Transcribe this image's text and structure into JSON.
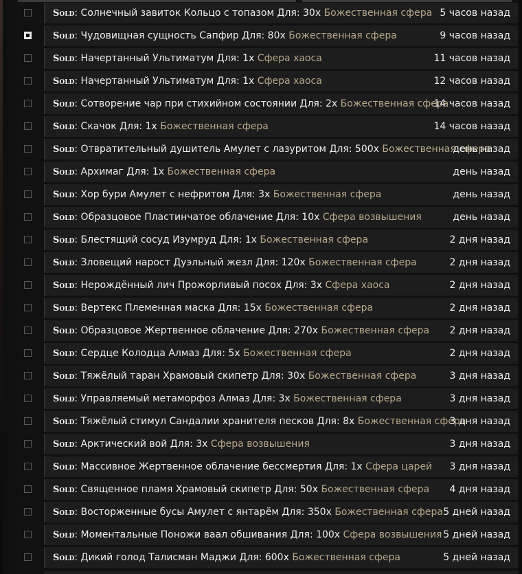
{
  "sold_label": "Sold",
  "sold_sep": ":",
  "for_word": "Для:",
  "rows": [
    {
      "checked": false,
      "item": "Солнечный завиток Кольцо с топазом",
      "qty": "30x",
      "currency": "Божественная сфера",
      "time": "5 часов назад"
    },
    {
      "checked": true,
      "item": "Чудовищная сущность Сапфир",
      "qty": "80x",
      "currency": "Божественная сфера",
      "time": "9 часов назад"
    },
    {
      "checked": false,
      "item": "Начертанный Ультиматум",
      "qty": "1x",
      "currency": "Сфера хаоса",
      "time": "11 часов назад"
    },
    {
      "checked": false,
      "item": "Начертанный Ультиматум",
      "qty": "1x",
      "currency": "Сфера хаоса",
      "time": "12 часов назад"
    },
    {
      "checked": false,
      "item": "Сотворение чар при стихийном состоянии",
      "qty": "2x",
      "currency": "Божественная сфера",
      "time": "14 часов назад"
    },
    {
      "checked": false,
      "item": "Скачок",
      "qty": "1x",
      "currency": "Божественная сфера",
      "time": "14 часов назад"
    },
    {
      "checked": false,
      "item": "Отвратительный душитель Амулет с лазуритом",
      "qty": "500x",
      "currency": "Божественная сфера",
      "time": "день назад"
    },
    {
      "checked": false,
      "item": "Архимаг",
      "qty": "1x",
      "currency": "Божественная сфера",
      "time": "день назад"
    },
    {
      "checked": false,
      "item": "Хор бури Амулет с нефритом",
      "qty": "3x",
      "currency": "Божественная сфера",
      "time": "день назад"
    },
    {
      "checked": false,
      "item": "Образцовое Пластинчатое облачение",
      "qty": "10x",
      "currency": "Сфера возвышения",
      "time": "день назад"
    },
    {
      "checked": false,
      "item": "Блестящий сосуд Изумруд",
      "qty": "1x",
      "currency": "Божественная сфера",
      "time": "2 дня назад"
    },
    {
      "checked": false,
      "item": "Зловещий нарост Дуэльный жезл",
      "qty": "120x",
      "currency": "Божественная сфера",
      "time": "2 дня назад"
    },
    {
      "checked": false,
      "item": "Нерождённый лич Прожорливый посох",
      "qty": "3x",
      "currency": "Сфера хаоса",
      "time": "2 дня назад"
    },
    {
      "checked": false,
      "item": "Вертекс Племенная маска",
      "qty": "15x",
      "currency": "Божественная сфера",
      "time": "2 дня назад"
    },
    {
      "checked": false,
      "item": "Образцовое Жертвенное облачение",
      "qty": "270x",
      "currency": "Божественная сфера",
      "time": "2 дня назад"
    },
    {
      "checked": false,
      "item": "Сердце Колодца Алмаз",
      "qty": "5x",
      "currency": "Божественная сфера",
      "time": "2 дня назад"
    },
    {
      "checked": false,
      "item": "Тяжёлый таран Храмовый скипетр",
      "qty": "30x",
      "currency": "Божественная сфера",
      "time": "3 дня назад"
    },
    {
      "checked": false,
      "item": "Управляемый метаморфоз Алмаз",
      "qty": "3x",
      "currency": "Божественная сфера",
      "time": "3 дня назад"
    },
    {
      "checked": false,
      "item": "Тяжёлый стимул Сандалии хранителя песков",
      "qty": "8x",
      "currency": "Божественная сфера",
      "time": "3 дня назад"
    },
    {
      "checked": false,
      "item": "Арктический вой",
      "qty": "3x",
      "currency": "Сфера возвышения",
      "time": "3 дня назад"
    },
    {
      "checked": false,
      "item": "Массивное Жертвенное облачение бессмертия",
      "qty": "1x",
      "currency": "Сфера царей",
      "time": "3 дня назад"
    },
    {
      "checked": false,
      "item": "Священное пламя Храмовый скипетр",
      "qty": "50x",
      "currency": "Божественная сфера",
      "time": "4 дня назад"
    },
    {
      "checked": false,
      "item": "Восторженные бусы Амулет с янтарём",
      "qty": "350x",
      "currency": "Божественная сфера",
      "time": "5 дней назад"
    },
    {
      "checked": false,
      "item": "Моментальные Поножи ваал обшивания",
      "qty": "100x",
      "currency": "Сфера возвышения",
      "time": "5 дней назад"
    },
    {
      "checked": false,
      "item": "Дикий голод Талисман Маджи",
      "qty": "600x",
      "currency": "Божественная сфера",
      "time": "5 дней назад"
    }
  ]
}
